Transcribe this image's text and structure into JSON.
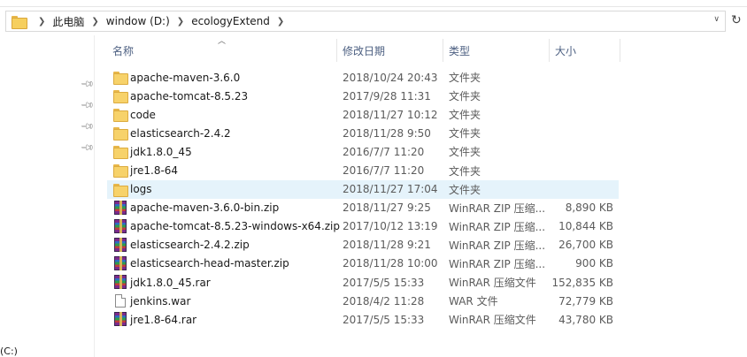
{
  "address_bar": {
    "crumbs": [
      "此电脑",
      "window (D:)",
      "ecologyExtend"
    ]
  },
  "nav": {
    "drive_label": "(C:)"
  },
  "columns": {
    "name": "名称",
    "date": "修改日期",
    "type": "类型",
    "size": "大小"
  },
  "files": [
    {
      "name": "apache-maven-3.6.0",
      "date": "2018/10/24 20:43",
      "type": "文件夹",
      "size": "",
      "kind": "folder"
    },
    {
      "name": "apache-tomcat-8.5.23",
      "date": "2017/9/28 11:31",
      "type": "文件夹",
      "size": "",
      "kind": "folder"
    },
    {
      "name": "code",
      "date": "2018/11/27 10:12",
      "type": "文件夹",
      "size": "",
      "kind": "folder"
    },
    {
      "name": "elasticsearch-2.4.2",
      "date": "2018/11/28 9:50",
      "type": "文件夹",
      "size": "",
      "kind": "folder"
    },
    {
      "name": "jdk1.8.0_45",
      "date": "2016/7/7 11:20",
      "type": "文件夹",
      "size": "",
      "kind": "folder"
    },
    {
      "name": "jre1.8-64",
      "date": "2016/7/7 11:20",
      "type": "文件夹",
      "size": "",
      "kind": "folder"
    },
    {
      "name": "logs",
      "date": "2018/11/27 17:04",
      "type": "文件夹",
      "size": "",
      "kind": "folder",
      "selected": true
    },
    {
      "name": "apache-maven-3.6.0-bin.zip",
      "date": "2018/11/27 9:25",
      "type": "WinRAR ZIP 压缩...",
      "size": "8,890 KB",
      "kind": "rar"
    },
    {
      "name": "apache-tomcat-8.5.23-windows-x64.zip",
      "date": "2017/10/12 13:19",
      "type": "WinRAR ZIP 压缩...",
      "size": "10,844 KB",
      "kind": "rar"
    },
    {
      "name": "elasticsearch-2.4.2.zip",
      "date": "2018/11/28 9:21",
      "type": "WinRAR ZIP 压缩...",
      "size": "26,700 KB",
      "kind": "rar"
    },
    {
      "name": "elasticsearch-head-master.zip",
      "date": "2018/11/28 10:00",
      "type": "WinRAR ZIP 压缩...",
      "size": "900 KB",
      "kind": "rar"
    },
    {
      "name": "jdk1.8.0_45.rar",
      "date": "2017/5/5 15:33",
      "type": "WinRAR 压缩文件",
      "size": "152,835 KB",
      "kind": "rar"
    },
    {
      "name": "jenkins.war",
      "date": "2018/4/2 11:28",
      "type": "WAR 文件",
      "size": "72,779 KB",
      "kind": "file"
    },
    {
      "name": "jre1.8-64.rar",
      "date": "2017/5/5 15:33",
      "type": "WinRAR 压缩文件",
      "size": "43,780 KB",
      "kind": "rar"
    }
  ]
}
